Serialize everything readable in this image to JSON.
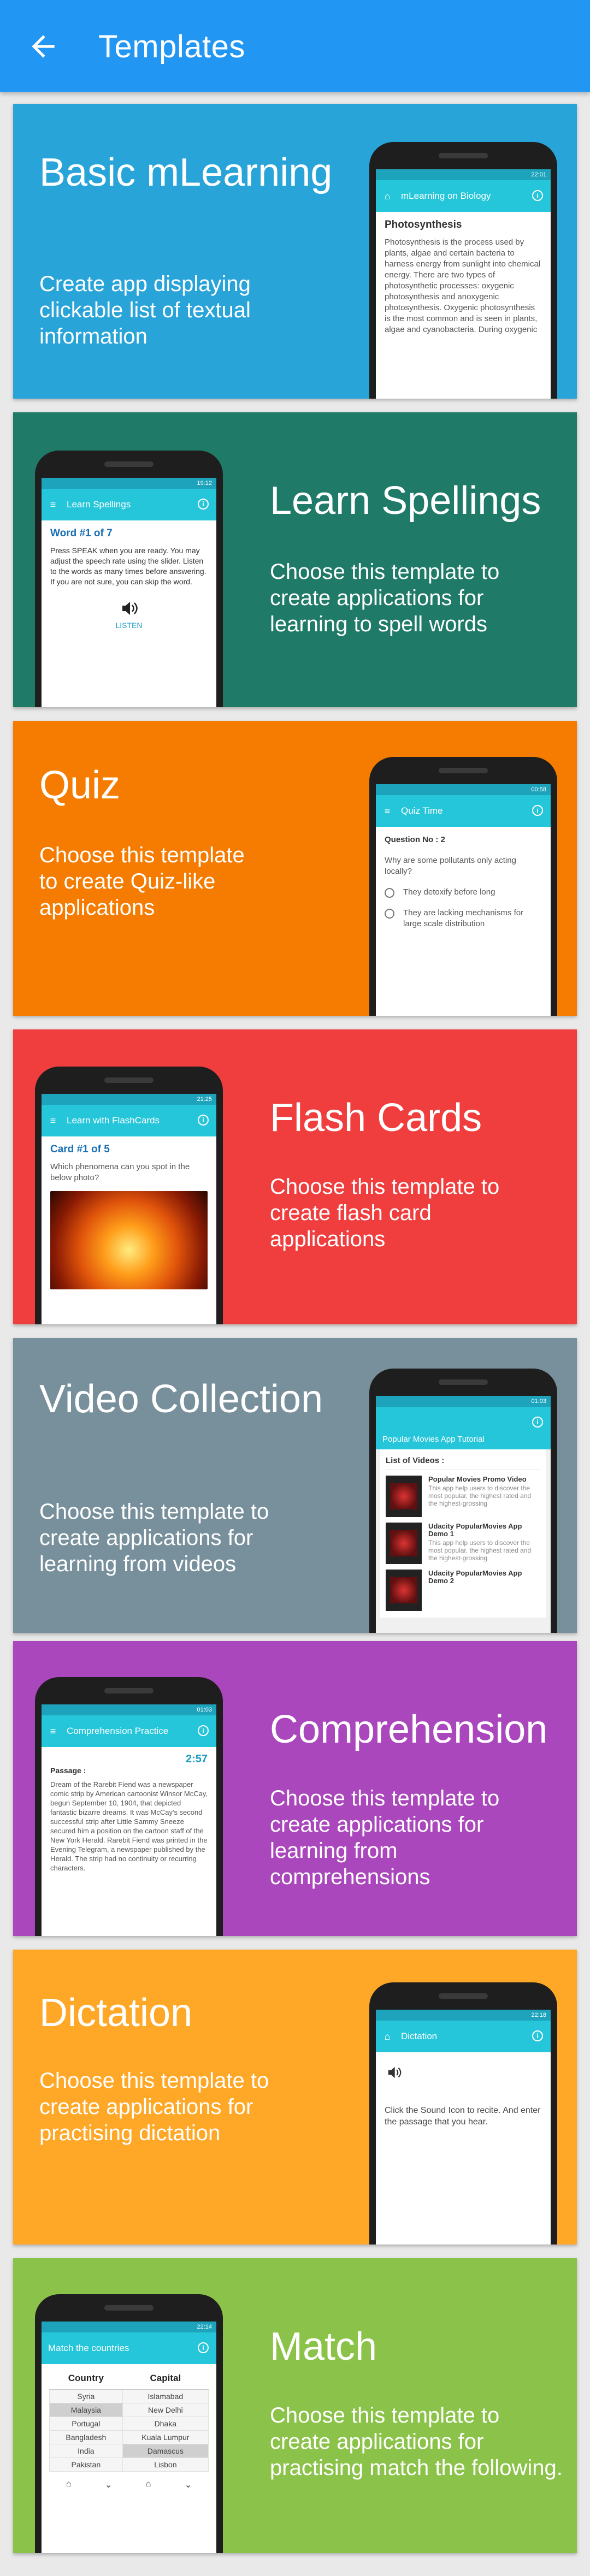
{
  "app_bar": {
    "title": "Templates",
    "back_icon": "arrow-back-icon",
    "color": "#2196f3"
  },
  "cards": [
    {
      "title": "Basic mLearning",
      "description": "Create app displaying clickable list of textual information",
      "color": "#29a4d9",
      "phone": {
        "time": "22:01",
        "toolbar_title": "mLearning on Biology",
        "heading": "Photosynthesis",
        "body": "Photosynthesis is the process used by plants, algae and certain bacteria to harness energy from sunlight into chemical energy. There are two types of photosynthetic processes: oxygenic photosynthesis and anoxygenic photosynthesis. Oxygenic photosynthesis is the most common and is seen in plants, algae and cyanobacteria. During oxygenic"
      }
    },
    {
      "title": "Learn Spellings",
      "description": "Choose this template to create applications for learning to spell words",
      "color": "#1f7a68",
      "phone": {
        "time": "19:12",
        "toolbar_title": "Learn Spellings",
        "heading": "Word #1 of 7",
        "body": "Press SPEAK when you are ready. You may adjust the speech rate using the slider. Listen to the words as many times before answering. If you are not sure, you can skip the word.",
        "button": "LISTEN"
      }
    },
    {
      "title": "Quiz",
      "description": "Choose this template to create Quiz-like applications",
      "color": "#f57c00",
      "phone": {
        "time": "00:58",
        "toolbar_title": "Quiz Time",
        "heading": "Question No : 2",
        "question": "Why are some pollutants only acting locally?",
        "options": [
          "They detoxify before long",
          "They are lacking mechanisms for large scale distribution"
        ]
      }
    },
    {
      "title": "Flash Cards",
      "description": "Choose this template to create flash card applications",
      "color": "#f03e3e",
      "phone": {
        "time": "21:25",
        "toolbar_title": "Learn with FlashCards",
        "heading": "Card #1 of 5",
        "body": "Which phenomena can you spot in the below photo?"
      }
    },
    {
      "title": "Video Collection",
      "description": "Choose this template to create applications for learning from videos",
      "color": "#78909c",
      "phone": {
        "time": "01:03",
        "toolbar_title": "Popular Movies App Tutorial",
        "list_heading": "List of Videos :",
        "videos": [
          {
            "title": "Popular Movies Promo Video",
            "text": "This app help users to discover the most popular, the highest rated and the highest-grossing"
          },
          {
            "title": "Udacity PopularMovies App Demo 1",
            "text": "This app help users to discover the most popular, the highest rated and the highest-grossing"
          },
          {
            "title": "Udacity PopularMovies App Demo 2",
            "text": ""
          }
        ]
      }
    },
    {
      "title": "Comprehension",
      "description": "Choose this template to create applications for learning from comprehensions",
      "color": "#ab47bc",
      "phone": {
        "time": "01:03",
        "toolbar_title": "Comprehension Practice",
        "timer": "2:57",
        "heading": "Passage :",
        "body": "Dream of the Rarebit Fiend was a newspaper comic strip by American cartoonist Winsor McCay, begun September 10, 1904, that depicted fantastic bizarre dreams. It was McCay's second successful strip after Little Sammy Sneeze secured him a position on the cartoon staff of the New York Herald. Rarebit Fiend was printed in the Evening Telegram, a newspaper published by the Herald. The strip had no continuity or recurring characters."
      }
    },
    {
      "title": "Dictation",
      "description": "Choose this template to create applications for practising dictation",
      "color": "#ffa726",
      "phone": {
        "time": "22:18",
        "toolbar_title": "Dictation",
        "body": "Click the Sound Icon to recite. And enter the passage that you hear."
      }
    },
    {
      "title": "Match",
      "description": "Choose this template to create applications for practising match the following.",
      "color": "#8bc34a",
      "phone": {
        "time": "22:14",
        "toolbar_title": "Match the countries",
        "col_a": "Country",
        "col_b": "Capital",
        "rows": [
          [
            "Syria",
            "Islamabad"
          ],
          [
            "Malaysia",
            "New Delhi"
          ],
          [
            "Portugal",
            "Dhaka"
          ],
          [
            "Bangladesh",
            "Kuala Lumpur"
          ],
          [
            "India",
            "Damascus"
          ],
          [
            "Pakistan",
            "Lisbon"
          ]
        ]
      }
    }
  ]
}
